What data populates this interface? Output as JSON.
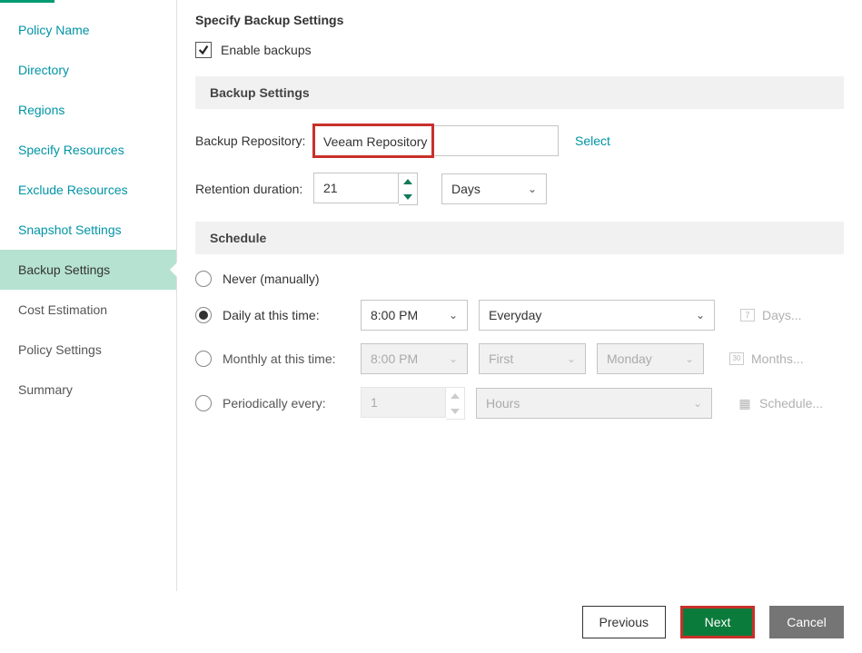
{
  "sidebar": {
    "items": [
      {
        "label": "Policy Name",
        "state": "pending"
      },
      {
        "label": "Directory",
        "state": "pending"
      },
      {
        "label": "Regions",
        "state": "pending"
      },
      {
        "label": "Specify Resources",
        "state": "pending"
      },
      {
        "label": "Exclude Resources",
        "state": "pending"
      },
      {
        "label": "Snapshot Settings",
        "state": "pending"
      },
      {
        "label": "Backup Settings",
        "state": "active"
      },
      {
        "label": "Cost Estimation",
        "state": "after"
      },
      {
        "label": "Policy Settings",
        "state": "after"
      },
      {
        "label": "Summary",
        "state": "after"
      }
    ]
  },
  "page": {
    "title": "Specify Backup Settings",
    "enable_label": "Enable backups",
    "enable_checked": true
  },
  "backup": {
    "section_title": "Backup Settings",
    "repo_label": "Backup Repository:",
    "repo_value": "Veeam Repository",
    "select_link": "Select",
    "retention_label": "Retention duration:",
    "retention_value": "21",
    "retention_unit": "Days"
  },
  "schedule": {
    "section_title": "Schedule",
    "never_label": "Never (manually)",
    "daily_label": "Daily at this time:",
    "daily_time": "8:00 PM",
    "daily_recurrence": "Everyday",
    "daily_days_btn": "Days...",
    "monthly_label": "Monthly at this time:",
    "monthly_time": "8:00 PM",
    "monthly_ordinal": "First",
    "monthly_weekday": "Monday",
    "monthly_months_btn": "Months...",
    "periodic_label": "Periodically every:",
    "periodic_value": "1",
    "periodic_unit": "Hours",
    "periodic_schedule_btn": "Schedule...",
    "selected": "daily"
  },
  "footer": {
    "previous": "Previous",
    "next": "Next",
    "cancel": "Cancel"
  },
  "icons": {
    "cal7": "7",
    "cal30": "30",
    "grid": "▦"
  }
}
